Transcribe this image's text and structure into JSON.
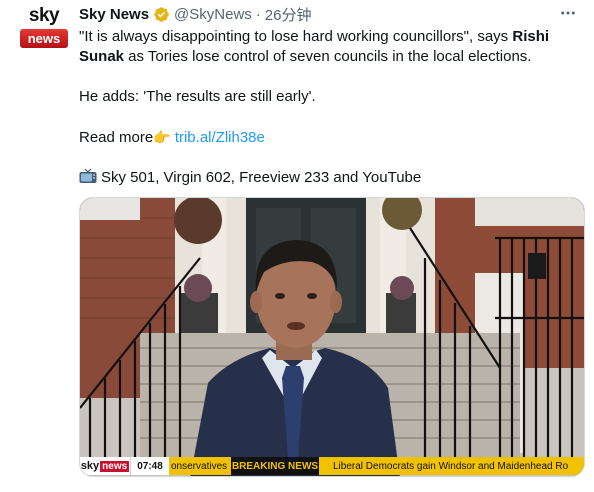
{
  "author": {
    "avatar_top": "sky",
    "avatar_bottom": "news",
    "name": "Sky News",
    "verified_icon": "verified-badge-gold",
    "handle": "@SkyNews",
    "separator": "·",
    "time": "26分钟",
    "more_icon": "more-horizontal-icon"
  },
  "tweet": {
    "line1_pre": "\"It is always disappointing to lose hard working councillors\", says ",
    "line1_bold": "Rishi Sunak",
    "line1_post": " as Tories lose control of seven councils in the local elections.",
    "line2": "He adds: 'The results are still early'.",
    "readmore_label": "Read more",
    "readmore_emoji": "👉",
    "readmore_link": "trib.al/Zlih38e",
    "tv_emoji_icon": "television-icon",
    "channels": "Sky 501, Virgin 602, Freeview 233 and YouTube"
  },
  "media": {
    "ticker_logo_sky": "sky",
    "ticker_logo_news": "news",
    "ticker_time": "07:48",
    "ticker_left": "onservatives",
    "ticker_breaking": "BREAKING NEWS",
    "ticker_right": "Liberal Democrats gain Windsor and Maidenhead Ro"
  },
  "colors": {
    "link": "#1d9bf0",
    "secondary_text": "#536471",
    "ticker_yellow": "#f2c200",
    "ticker_black": "#111111",
    "sky_red": "#c8102e"
  }
}
